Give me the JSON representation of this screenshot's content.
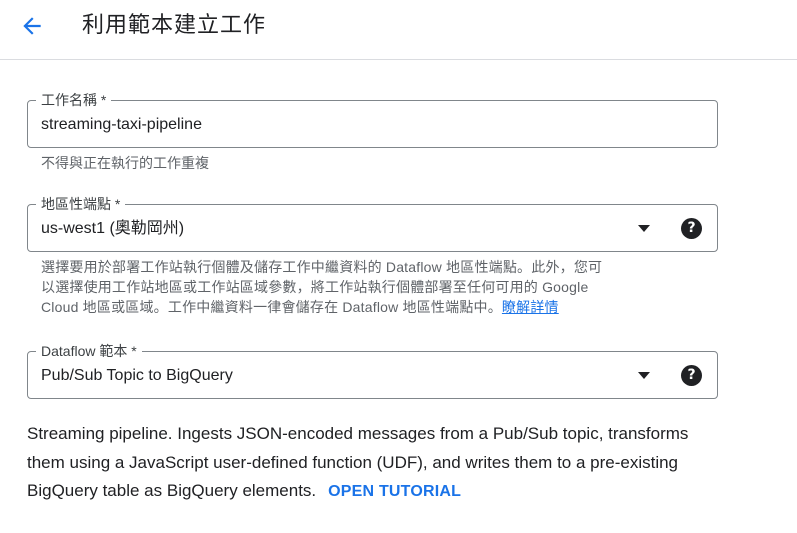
{
  "header": {
    "title": "利用範本建立工作"
  },
  "job_name": {
    "label": "工作名稱 *",
    "value": "streaming-taxi-pipeline",
    "hint": "不得與正在執行的工作重複"
  },
  "region": {
    "label": "地區性端點 *",
    "value": "us-west1 (奧勒岡州)",
    "hint_line1": "選擇要用於部署工作站執行個體及儲存工作中繼資料的 Dataflow 地區性端點。此外，您可",
    "hint_line2": "以選擇使用工作站地區或工作站區域參數，將工作站執行個體部署至任何可用的 Google",
    "hint_line3": "Cloud 地區或區域。工作中繼資料一律會儲存在 Dataflow 地區性端點中。",
    "learn_more": "瞭解詳情"
  },
  "template": {
    "label": "Dataflow 範本 *",
    "value": "Pub/Sub Topic to BigQuery"
  },
  "description": {
    "line1": "Streaming pipeline. Ingests JSON-encoded messages from a Pub/Sub topic, transforms",
    "line2": "them using a JavaScript user-defined function (UDF), and writes them to a pre-existing",
    "line3": "BigQuery table as BigQuery elements.",
    "tutorial": "OPEN TUTORIAL"
  },
  "icons": {
    "back": "arrow-back-icon",
    "dropdown": "arrow-drop-down-icon",
    "help": "help-icon"
  },
  "colors": {
    "accent": "#1a73e8",
    "text": "#202124",
    "hint": "#5f6368",
    "border": "#80868b"
  }
}
